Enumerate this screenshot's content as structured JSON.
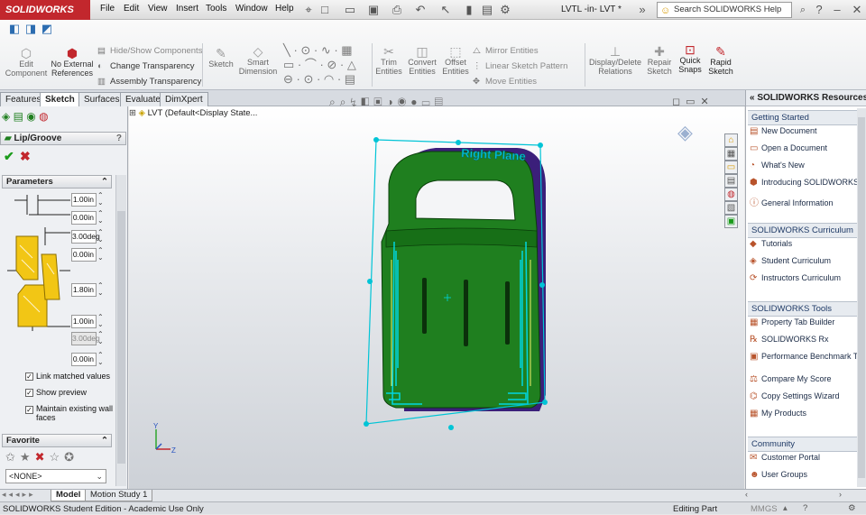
{
  "app": {
    "logo": "SOLIDWORKS",
    "document_title": "LVTL -in- LVT *"
  },
  "menu": [
    "File",
    "Edit",
    "View",
    "Insert",
    "Tools",
    "Window",
    "Help"
  ],
  "search": {
    "placeholder": "Search SOLIDWORKS Help"
  },
  "commands": {
    "edit_component": "Edit Component",
    "no_external_refs": "No External References",
    "hide_show": "Hide/Show Components",
    "change_transparency": "Change Transparency",
    "assembly_transparency": "Assembly Transparency",
    "sketch": "Sketch",
    "smart_dimension": "Smart Dimension",
    "trim_entities": "Trim Entities",
    "convert_entities": "Convert Entities",
    "offset_entities": "Offset Entities",
    "mirror_entities": "Mirror Entities",
    "linear_sketch_pattern": "Linear Sketch Pattern",
    "move_entities": "Move Entities",
    "display_delete_relations": "Display/Delete Relations",
    "repair_sketch": "Repair Sketch",
    "quick_snaps": "Quick Snaps",
    "rapid_sketch": "Rapid Sketch"
  },
  "tabs": [
    "Features",
    "Sketch",
    "Surfaces",
    "Evaluate",
    "DimXpert"
  ],
  "active_tab": "Sketch",
  "feature": {
    "name": "Lip/Groove",
    "section_params": "Parameters",
    "values": [
      "1.00in",
      "0.00in",
      "3.00deg",
      "0.00in",
      "1.80in",
      "1.00in",
      "3.00deg",
      "0.00in"
    ],
    "disabled_index": 6,
    "options": [
      {
        "label": "Link matched values",
        "checked": true
      },
      {
        "label": "Show preview",
        "checked": true
      },
      {
        "label": "Maintain existing wall faces",
        "checked": true
      }
    ],
    "favorite_head": "Favorite",
    "favorite_value": "<NONE>"
  },
  "tree": {
    "root": "LVT  (Default<Display State..."
  },
  "model": {
    "plane_label": "Right Plane"
  },
  "resources": {
    "title": "SOLIDWORKS Resources",
    "sections": [
      {
        "head": "Getting Started",
        "items": [
          "New Document",
          "Open a Document",
          "What's New",
          "Introducing SOLIDWORKS",
          "General Information"
        ]
      },
      {
        "head": "SOLIDWORKS Curriculum",
        "items": [
          "Tutorials",
          "Student Curriculum",
          "Instructors Curriculum"
        ]
      },
      {
        "head": "SOLIDWORKS Tools",
        "items": [
          "Property Tab Builder",
          "SOLIDWORKS Rx",
          "Performance Benchmark Test",
          "Compare My Score",
          "Copy Settings Wizard",
          "My Products"
        ]
      },
      {
        "head": "Community",
        "items": [
          "Customer Portal",
          "User Groups"
        ]
      }
    ]
  },
  "bottom_tabs": [
    "Model",
    "Motion Study 1"
  ],
  "status": {
    "left": "SOLIDWORKS Student Edition - Academic Use Only",
    "mode": "Editing Part",
    "units": "MMGS"
  },
  "colors": {
    "model_green": "#1f7f1f",
    "sketch_cyan": "#00d6e0",
    "purple": "#3b1f7a",
    "brand_red": "#c2272d"
  }
}
